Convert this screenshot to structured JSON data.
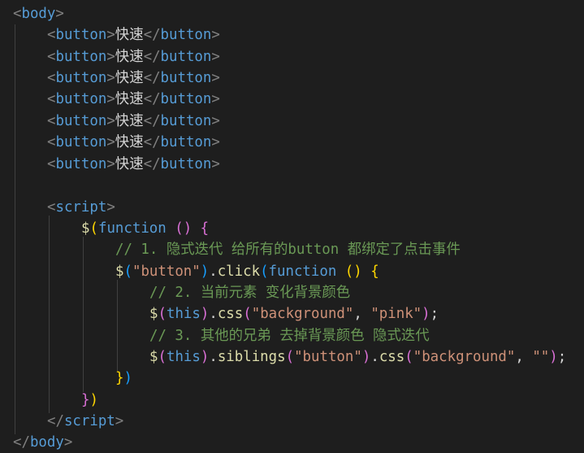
{
  "colors": {
    "background": "#1e1e1e",
    "tag": "#569cd6",
    "bracket_punct": "#808080",
    "text": "#d4d4d4",
    "function_name": "#dcdcaa",
    "keyword": "#569cd6",
    "string": "#ce9178",
    "comment": "#6a9955",
    "bracket_level_1": "#ffd700",
    "bracket_level_2": "#da70d6",
    "bracket_level_3": "#179fff"
  },
  "code": {
    "body_tag": "body",
    "button_tag": "button",
    "button_text": "快速",
    "script_tag": "script",
    "dollar": "$",
    "function_kw": "function",
    "this_kw": "this",
    "comment1": "// 1. 隐式迭代 给所有的button 都绑定了点击事件",
    "comment2": "// 2. 当前元素 变化背景颜色",
    "comment3": "// 3. 其他的兄弟 去掉背景颜色 隐式迭代",
    "str_button": "\"button\"",
    "str_background": "\"background\"",
    "str_pink": "\"pink\"",
    "str_empty": "\"\"",
    "click_fn": "click",
    "css_fn": "css",
    "siblings_fn": "siblings"
  }
}
